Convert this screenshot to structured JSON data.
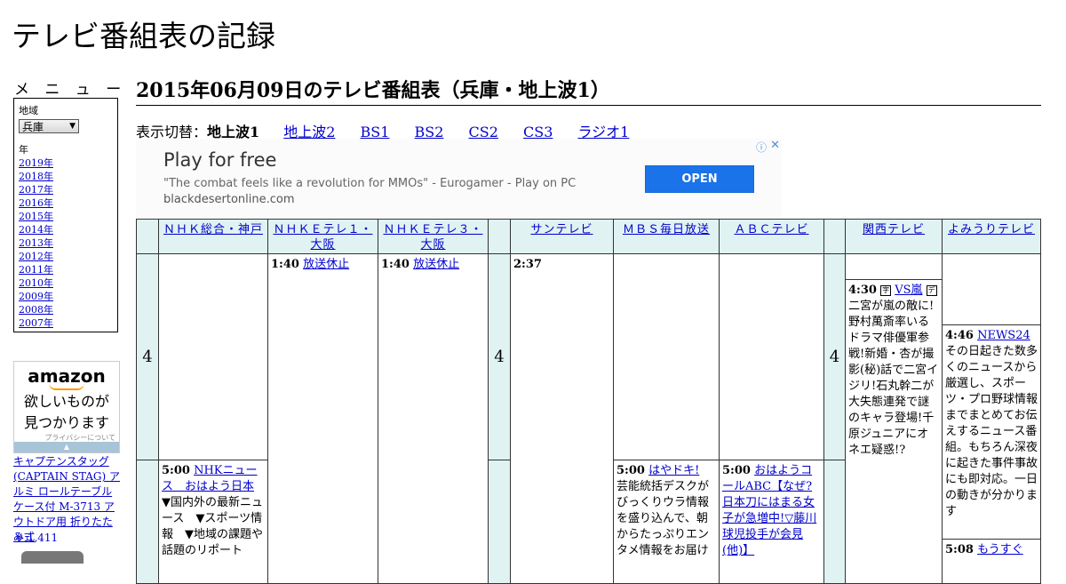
{
  "site_title": "テレビ番組表の記録",
  "menu": {
    "heading": "メ ニ ュ ー",
    "region_label": "地域",
    "region_value": "兵庫",
    "year_label": "年",
    "years": [
      "2019年",
      "2018年",
      "2017年",
      "2016年",
      "2015年",
      "2014年",
      "2013年",
      "2012年",
      "2011年",
      "2010年",
      "2009年",
      "2008年",
      "2007年"
    ]
  },
  "amazon_ad": {
    "logo": "amazon",
    "tagline_1": "欲しいものが",
    "tagline_2": "見つかります",
    "privacy": "プライバシーについて",
    "product_text": "キャプテンスタッグ (CAPTAIN STAG) アルミ ロールテーブル ケース付 M-3713 アウトドア用 折りたたみ式",
    "product_price": "￥ 1,411"
  },
  "page_heading": "2015年06月09日のテレビ番組表（兵庫・地上波1）",
  "switcher": {
    "label": "表示切替：",
    "current": "地上波1",
    "links": [
      "地上波2",
      "BS1",
      "BS2",
      "CS2",
      "CS3",
      "ラジオ1"
    ]
  },
  "banner_ad": {
    "headline": "Play for free",
    "description": "\"The combat feels like a revolution for MMOs\" - Eurogamer - Play on PC",
    "domain": "blackdesertonline.com",
    "button": "OPEN",
    "info_icon": "ⓘ",
    "close_icon": "✕"
  },
  "channels": [
    "ＮＨＫ総合・神戸",
    "ＮＨＫＥテレ１・大阪",
    "ＮＨＫＥテレ３・大阪",
    "サンテレビ",
    "ＭＢＳ毎日放送",
    "ＡＢＣテレビ",
    "関西テレビ",
    "よみうりテレビ"
  ],
  "hour_label": "4",
  "programs": {
    "etele1_0140": {
      "time": "1:40",
      "title": "放送休止"
    },
    "etele3_0140": {
      "time": "1:40",
      "title": "放送休止"
    },
    "sun_0237": {
      "time": "2:37"
    },
    "kantele_0430": {
      "time": "4:30",
      "title": "VS嵐",
      "desc": "二宮が嵐の敵に!野村萬斎率いるドラマ俳優軍参戦!新婚・杏が撮影(秘)話で二宮イジリ!石丸幹二が大失態連発で謎のキャラ登場!千原ジュニアにオネエ疑惑!?"
    },
    "ytv_0446": {
      "time": "4:46",
      "title": "NEWS24",
      "desc": "その日起きた数多くのニュースから厳選し、スポーツ・プロ野球情報までまとめてお伝えするニュース番組。もちろん深夜に起きた事件事故にも即対応。一日の動きが分かります"
    },
    "ytv_0508": {
      "time": "5:08",
      "title": "もうすぐ"
    },
    "nhk_0500": {
      "time": "5:00",
      "title": "NHKニュース　おはよう日本",
      "desc": "▼国内外の最新ニュース　▼スポーツ情報　▼地域の課題や話題のリポート"
    },
    "mbs_0500": {
      "time": "5:00",
      "title": "はやドキ!",
      "desc": "芸能統括デスクがびっくりウラ情報を盛り込んで、朝からたっぷりエンタメ情報をお届け"
    },
    "abc_0500": {
      "time": "5:00",
      "title": "おはようコールABC【なぜ?日本刀にはまる女子が急増中!▽藤川球児投手が会見(他)】"
    }
  }
}
